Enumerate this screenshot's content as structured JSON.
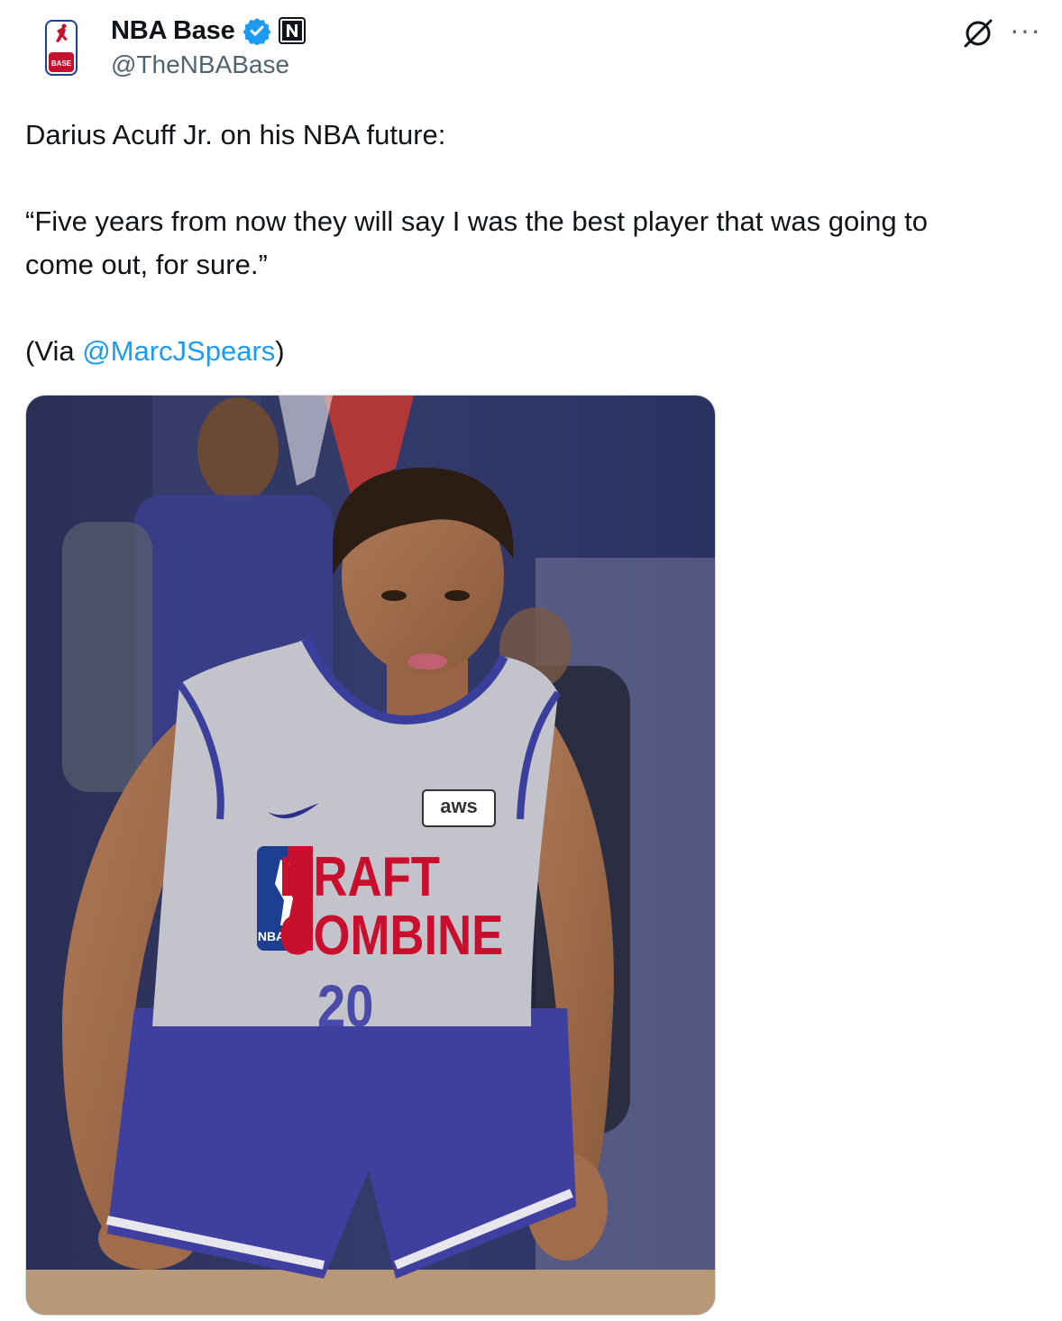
{
  "author": {
    "display_name": "NBA Base",
    "handle": "@TheNBABase",
    "logo_text": "BASE",
    "verified": true,
    "affiliation_badge_icon": "n-badge-icon"
  },
  "header_actions": {
    "grok_icon": "grok-icon",
    "more_label": "···"
  },
  "tweet": {
    "line1": "Darius Acuff Jr. on his NBA future:",
    "line2": "“Five years from now they will say I was the best player that was going to",
    "line3": "come out, for sure.”",
    "via_prefix": "(Via ",
    "mention": "@MarcJSpears",
    "via_suffix": ")"
  },
  "media": {
    "jersey_text_1": "DRAFT",
    "jersey_text_2": "COMBINE",
    "jersey_number": "20",
    "jersey_sponsor": "aws",
    "jersey_logo_text": "NBA"
  },
  "colors": {
    "accent": "#1d9bf0",
    "text": "#0f1419",
    "muted": "#536471"
  }
}
